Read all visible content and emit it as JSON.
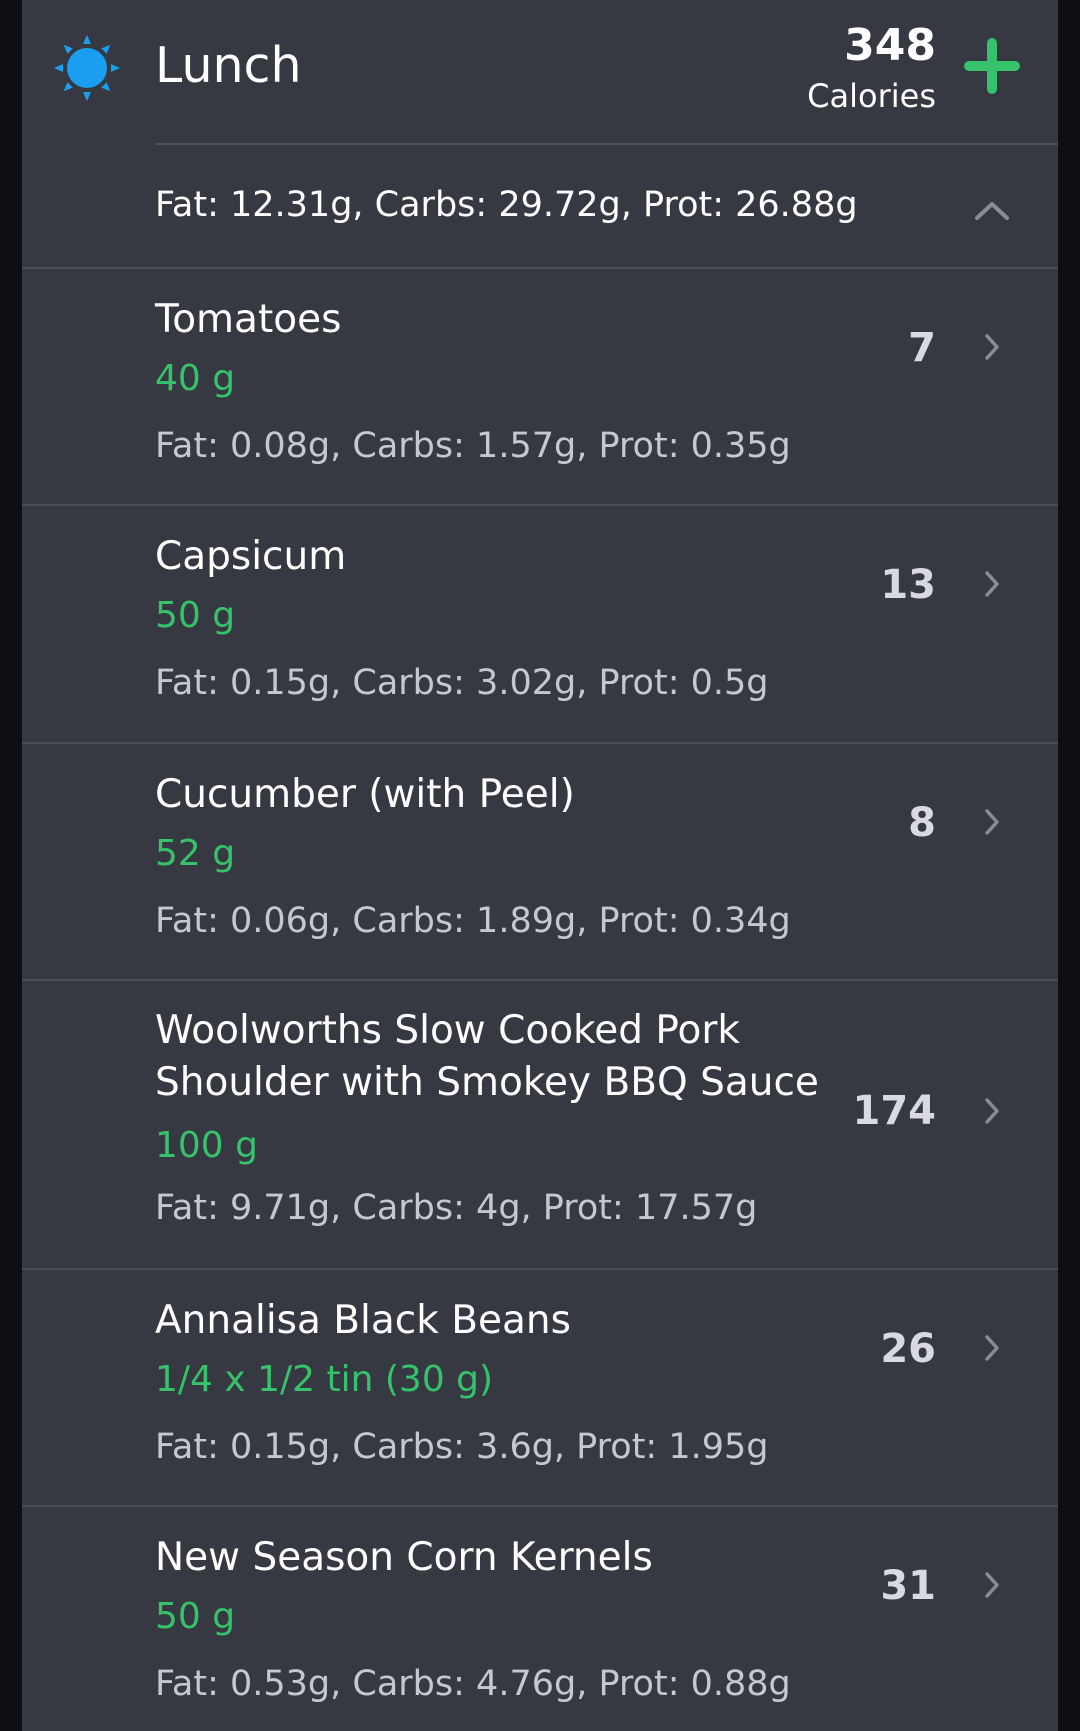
{
  "meal": {
    "title": "Lunch",
    "icon": "sun-icon",
    "total_calories": "348",
    "calories_label": "Calories",
    "summary": "Fat: 12.31g, Carbs: 29.72g, Prot: 26.88g"
  },
  "colors": {
    "background": "#0e0f13",
    "card": "#363842",
    "accent_green": "#35c26a",
    "sun_blue": "#1a9ff0"
  },
  "foods": [
    {
      "name": "Tomatoes",
      "quantity": "40 g",
      "macros": "Fat: 0.08g, Carbs: 1.57g, Prot: 0.35g",
      "calories": "7"
    },
    {
      "name": "Capsicum",
      "quantity": "50 g",
      "macros": "Fat: 0.15g, Carbs: 3.02g, Prot: 0.5g",
      "calories": "13"
    },
    {
      "name": "Cucumber (with Peel)",
      "quantity": "52 g",
      "macros": "Fat: 0.06g, Carbs: 1.89g, Prot: 0.34g",
      "calories": "8"
    },
    {
      "name": "Woolworths Slow Cooked Pork Shoulder with Smokey BBQ Sauce",
      "quantity": "100 g",
      "macros": "Fat: 9.71g, Carbs: 4g, Prot: 17.57g",
      "calories": "174"
    },
    {
      "name": "Annalisa Black Beans",
      "quantity": "1/4 x 1/2 tin (30 g)",
      "macros": "Fat: 0.15g, Carbs: 3.6g, Prot: 1.95g",
      "calories": "26"
    },
    {
      "name": "New Season Corn Kernels",
      "quantity": "50 g",
      "macros": "Fat: 0.53g, Carbs: 4.76g, Prot: 0.88g",
      "calories": "31"
    }
  ]
}
